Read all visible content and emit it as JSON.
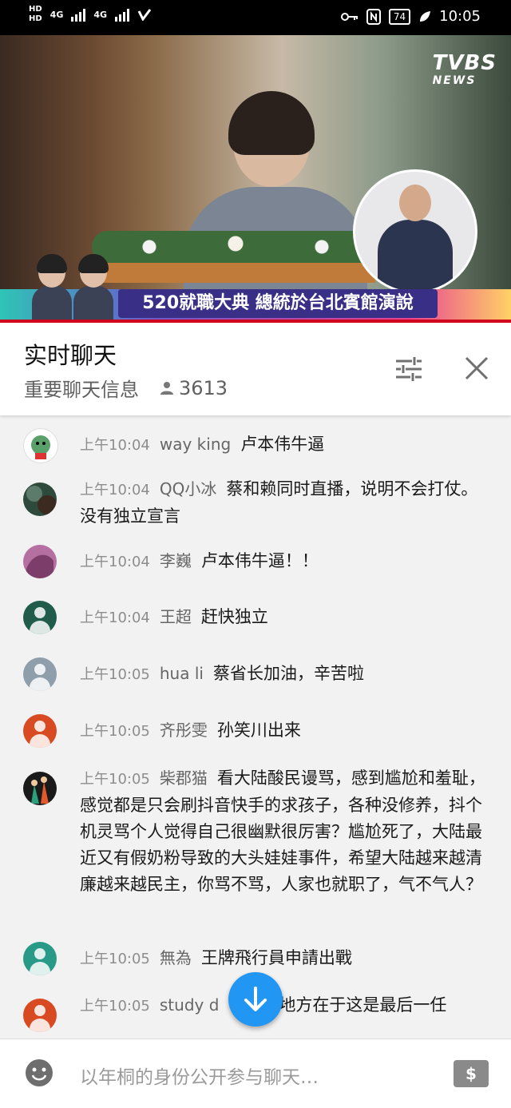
{
  "status_bar": {
    "hd1": "HD",
    "hd2": "HD",
    "net1": "4G",
    "net2": "4G",
    "battery": "74",
    "time": "10:05"
  },
  "video": {
    "logo_main": "TVBS",
    "logo_sub": "NEWS",
    "banner": "520就職大典 總統於台北賓館演說"
  },
  "chat": {
    "title": "实时聊天",
    "subtitle": "重要聊天信息",
    "viewers": "3613"
  },
  "messages": [
    {
      "time": "上午10:04",
      "author": "way king",
      "text": "卢本伟牛逼",
      "avatar_color": "#ffffff"
    },
    {
      "time": "上午10:04",
      "author": "QQ小冰",
      "text": "蔡和赖同时直播，说明不会打仗。没有独立宣言",
      "avatar_color": "#2e4a3d"
    },
    {
      "time": "上午10:04",
      "author": "李巍",
      "text": "卢本伟牛逼！！",
      "avatar_color": "#b56fa0"
    },
    {
      "time": "上午10:04",
      "author": "王超",
      "text": "赶快独立",
      "avatar_color": "#1f5c4a"
    },
    {
      "time": "上午10:05",
      "author": "hua li",
      "text": "蔡省长加油，辛苦啦",
      "avatar_color": "#8e9eab"
    },
    {
      "time": "上午10:05",
      "author": "齐彤雯",
      "text": "孙笑川出来",
      "avatar_color": "#d84a22"
    },
    {
      "time": "上午10:05",
      "author": "柴郡猫",
      "text": "看大陆酸民谩骂，感到尴尬和羞耻，感觉都是只会刷抖音快手的求孩子，各种没修养，抖个机灵骂个人觉得自己很幽默很厉害？尴尬死了，大陆最近又有假奶粉导致的大头娃娃事件，希望大陆越来越清廉越来越民主，你骂不骂，人家也就职了，气不气人？",
      "avatar_color": "#1a1a1a"
    },
    {
      "time": "上午10:05",
      "author": "無為",
      "text": "王牌飛行員申請出戰",
      "avatar_color": "#2a9a88"
    },
    {
      "time": "上午10:05",
      "author": "study d",
      "text": "特别的地方在于这是最后一任",
      "avatar_color": "#d84a22"
    }
  ],
  "input": {
    "placeholder": "以年桐的身份公开参与聊天…",
    "money_icon_label": "$"
  },
  "colors": {
    "accent": "#2196f3",
    "red_line": "#d0021b"
  }
}
